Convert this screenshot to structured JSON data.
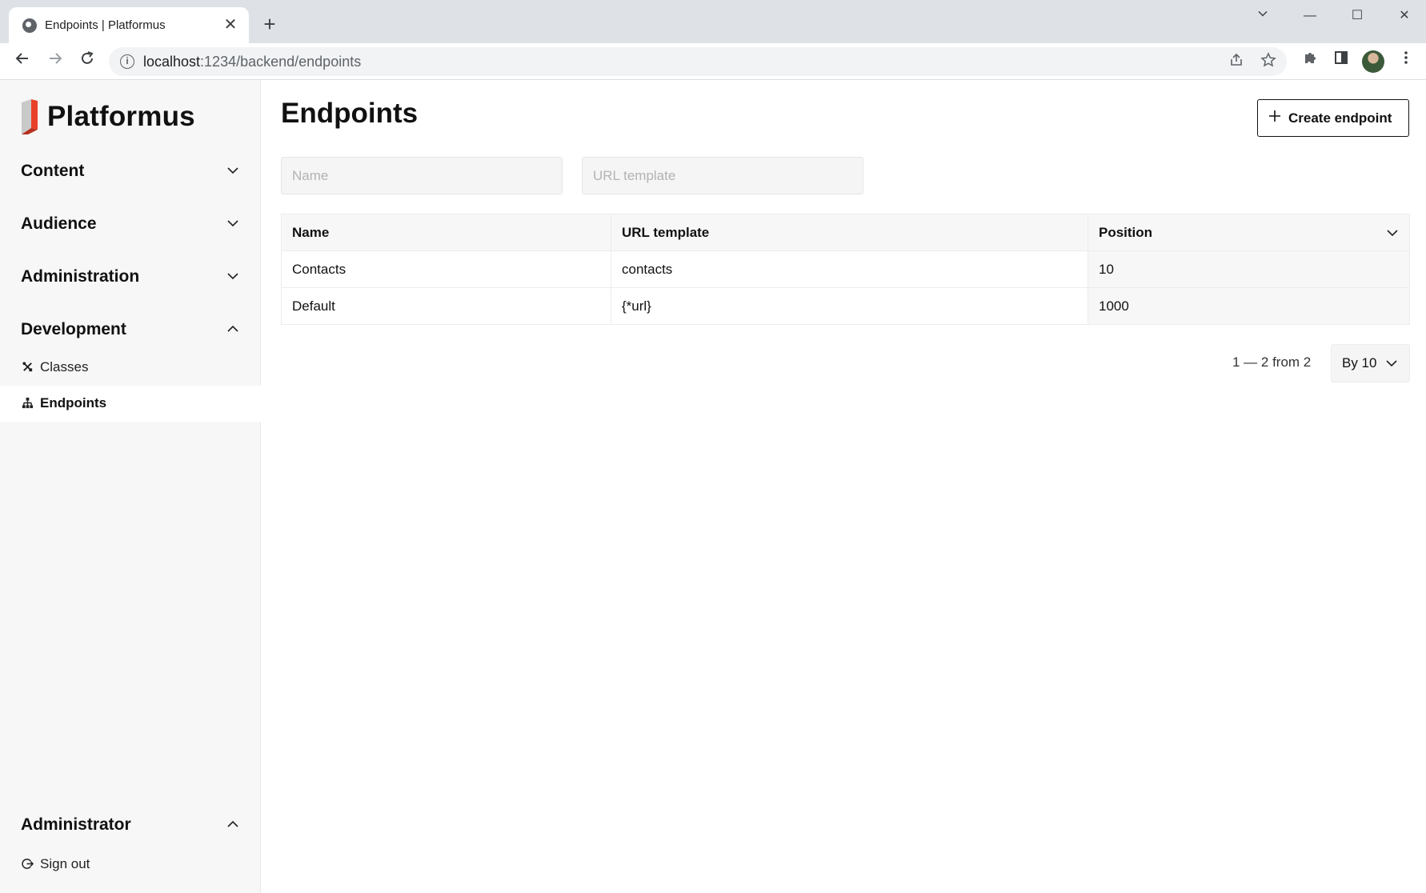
{
  "browser": {
    "tab_title": "Endpoints | Platformus",
    "tab_close": "✕",
    "new_tab": "+",
    "url_host": "localhost",
    "url_rest": ":1234/backend/endpoints",
    "win_min": "—",
    "win_max": "☐",
    "win_close": "✕",
    "win_tabsearch": "⌄"
  },
  "sidebar": {
    "logo_text": "Platformus",
    "groups": [
      {
        "label": "Content",
        "expanded": false
      },
      {
        "label": "Audience",
        "expanded": false
      },
      {
        "label": "Administration",
        "expanded": false
      },
      {
        "label": "Development",
        "expanded": true
      }
    ],
    "dev_items": [
      {
        "label": "Classes",
        "icon": "tools-icon"
      },
      {
        "label": "Endpoints",
        "icon": "sitemap-icon",
        "active": true
      }
    ],
    "user_group": {
      "label": "Administrator",
      "expanded": true
    },
    "user_items": [
      {
        "label": "Sign out",
        "icon": "sign-out-icon"
      }
    ]
  },
  "main": {
    "title": "Endpoints",
    "create_button": "Create endpoint",
    "filters": {
      "name_placeholder": "Name",
      "url_placeholder": "URL template"
    },
    "table": {
      "columns": [
        "Name",
        "URL template",
        "Position"
      ],
      "rows": [
        [
          "Contacts",
          "contacts",
          "10"
        ],
        [
          "Default",
          "{*url}",
          "1000"
        ]
      ]
    },
    "pager": {
      "summary": "1 — 2 from 2",
      "page_size": "By 10"
    }
  },
  "colors": {
    "logo_red": "#e8402a",
    "sidebar_bg": "#f7f7f7"
  }
}
